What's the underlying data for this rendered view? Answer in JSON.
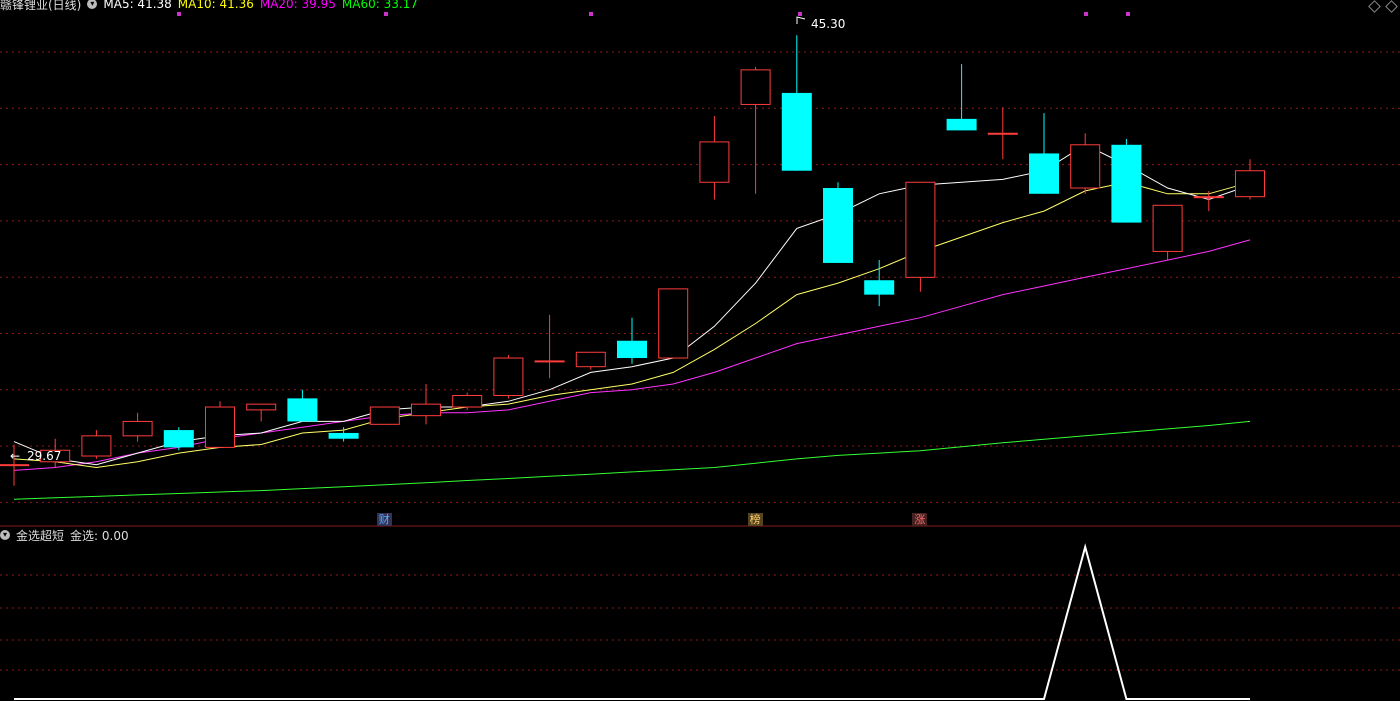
{
  "header": {
    "stock_title": "赣锋锂业(日线)",
    "indicators": [
      {
        "label": "MA5: 41.38",
        "color": "#ffffff"
      },
      {
        "label": "MA10: 41.36",
        "color": "#ffff00"
      },
      {
        "label": "MA20: 39.95",
        "color": "#ff00ff"
      },
      {
        "label": "MA60: 33.17",
        "color": "#00ff00"
      }
    ]
  },
  "subpanel": {
    "title": "金选超短",
    "value_label": "金选: 0.00"
  },
  "event_tags": [
    {
      "label": "财",
      "color": "#55aaff",
      "bg": "#333355",
      "candle_index": 9
    },
    {
      "label": "榜",
      "color": "#ffcc66",
      "bg": "#554422",
      "candle_index": 18
    },
    {
      "label": "涨",
      "color": "#ff6666",
      "bg": "#442222",
      "candle_index": 22
    }
  ],
  "annotations": {
    "high": "45.30",
    "low": "29.67"
  },
  "colors": {
    "up": "#ff3c3c",
    "down": "#00ffff",
    "ma5": "#ffffff",
    "ma10": "#ffff66",
    "ma20": "#ff33ff",
    "ma60": "#33ff33",
    "grid": "#8b1a1a"
  },
  "chart_data": {
    "type": "candlestick",
    "y_range": [
      29.0,
      45.9
    ],
    "candles": [
      {
        "o": 30.4,
        "h": 31.1,
        "l": 29.67,
        "c": 30.4
      },
      {
        "o": 30.5,
        "h": 31.3,
        "l": 30.3,
        "c": 30.9
      },
      {
        "o": 30.7,
        "h": 31.6,
        "l": 30.6,
        "c": 31.4
      },
      {
        "o": 31.4,
        "h": 32.2,
        "l": 31.2,
        "c": 31.9
      },
      {
        "o": 31.6,
        "h": 31.7,
        "l": 30.9,
        "c": 31.0
      },
      {
        "o": 31.0,
        "h": 32.6,
        "l": 31.0,
        "c": 32.4
      },
      {
        "o": 32.3,
        "h": 32.5,
        "l": 31.9,
        "c": 32.5
      },
      {
        "o": 32.7,
        "h": 33.0,
        "l": 31.9,
        "c": 31.9
      },
      {
        "o": 31.5,
        "h": 31.7,
        "l": 31.2,
        "c": 31.3
      },
      {
        "o": 31.8,
        "h": 32.4,
        "l": 31.8,
        "c": 32.4
      },
      {
        "o": 32.1,
        "h": 33.2,
        "l": 31.8,
        "c": 32.5
      },
      {
        "o": 32.4,
        "h": 32.9,
        "l": 32.3,
        "c": 32.8
      },
      {
        "o": 32.8,
        "h": 34.2,
        "l": 32.7,
        "c": 34.1
      },
      {
        "o": 34.0,
        "h": 35.6,
        "l": 33.4,
        "c": 34.0
      },
      {
        "o": 33.8,
        "h": 34.3,
        "l": 33.7,
        "c": 34.3
      },
      {
        "o": 34.7,
        "h": 35.5,
        "l": 33.9,
        "c": 34.1
      },
      {
        "o": 34.1,
        "h": 36.5,
        "l": 34.1,
        "c": 36.5
      },
      {
        "o": 40.2,
        "h": 42.5,
        "l": 39.6,
        "c": 41.6
      },
      {
        "o": 42.9,
        "h": 44.2,
        "l": 39.8,
        "c": 44.1
      },
      {
        "o": 43.3,
        "h": 45.3,
        "l": 40.6,
        "c": 40.6
      },
      {
        "o": 40.0,
        "h": 40.2,
        "l": 37.4,
        "c": 37.4
      },
      {
        "o": 36.8,
        "h": 37.5,
        "l": 35.9,
        "c": 36.3
      },
      {
        "o": 36.9,
        "h": 40.0,
        "l": 36.4,
        "c": 40.2
      },
      {
        "o": 42.4,
        "h": 44.3,
        "l": 42.0,
        "c": 42.0
      },
      {
        "o": 41.9,
        "h": 42.8,
        "l": 41.0,
        "c": 41.9
      },
      {
        "o": 41.2,
        "h": 42.6,
        "l": 39.8,
        "c": 39.8
      },
      {
        "o": 40.0,
        "h": 41.9,
        "l": 39.8,
        "c": 41.5
      },
      {
        "o": 41.5,
        "h": 41.7,
        "l": 38.8,
        "c": 38.8
      },
      {
        "o": 37.8,
        "h": 39.0,
        "l": 37.5,
        "c": 39.4
      },
      {
        "o": 39.7,
        "h": 39.9,
        "l": 39.2,
        "c": 39.7
      },
      {
        "o": 39.7,
        "h": 41.0,
        "l": 39.6,
        "c": 40.6
      }
    ],
    "ma5": [
      31.2,
      30.6,
      30.4,
      30.8,
      31.2,
      31.4,
      31.5,
      31.9,
      31.9,
      32.3,
      32.4,
      32.4,
      32.6,
      33.0,
      33.6,
      33.8,
      34.1,
      35.2,
      36.7,
      38.6,
      39.1,
      39.8,
      40.1,
      40.2,
      40.3,
      40.6,
      41.5,
      40.8,
      40.0,
      39.6,
      40.1
    ],
    "ma10": [
      30.6,
      30.5,
      30.3,
      30.5,
      30.8,
      31.0,
      31.1,
      31.5,
      31.6,
      32.0,
      32.2,
      32.4,
      32.5,
      32.8,
      33.0,
      33.2,
      33.6,
      34.4,
      35.3,
      36.3,
      36.7,
      37.2,
      37.8,
      38.3,
      38.8,
      39.2,
      39.9,
      40.2,
      39.8,
      39.8,
      40.2
    ],
    "ma20": [
      30.2,
      30.3,
      30.5,
      30.8,
      31.0,
      31.3,
      31.5,
      31.7,
      31.9,
      32.1,
      32.2,
      32.2,
      32.3,
      32.6,
      32.9,
      33.0,
      33.2,
      33.6,
      34.1,
      34.6,
      34.9,
      35.2,
      35.5,
      35.9,
      36.3,
      36.6,
      36.9,
      37.2,
      37.5,
      37.8,
      38.2
    ],
    "ma60": [
      29.2,
      29.25,
      29.3,
      29.35,
      29.4,
      29.45,
      29.5,
      29.57,
      29.63,
      29.7,
      29.77,
      29.85,
      29.92,
      30.0,
      30.07,
      30.15,
      30.22,
      30.3,
      30.45,
      30.6,
      30.72,
      30.8,
      30.88,
      31.02,
      31.16,
      31.28,
      31.4,
      31.52,
      31.64,
      31.76,
      31.9
    ],
    "sub_indicator": {
      "name": "金选",
      "y_range": [
        0,
        1
      ],
      "values": [
        0,
        0,
        0,
        0,
        0,
        0,
        0,
        0,
        0,
        0,
        0,
        0,
        0,
        0,
        0,
        0,
        0,
        0,
        0,
        0,
        0,
        0,
        0,
        0,
        0,
        0,
        1,
        0,
        0,
        0,
        0
      ]
    }
  }
}
